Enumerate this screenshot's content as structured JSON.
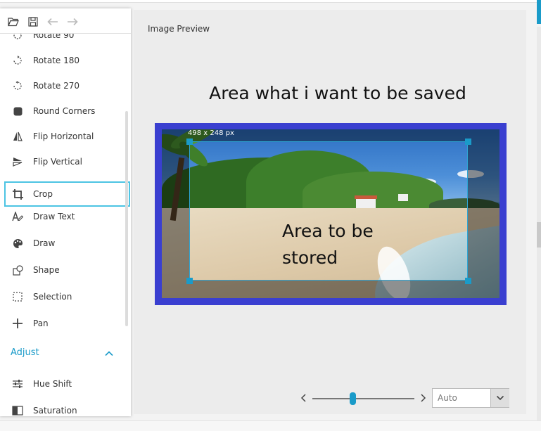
{
  "toolbar": {
    "icons": [
      "folder-open-icon",
      "save-icon",
      "undo-icon",
      "redo-icon"
    ]
  },
  "menu": {
    "items": [
      {
        "label": "Rotate 90",
        "icon": "rotate-90-icon"
      },
      {
        "label": "Rotate 180",
        "icon": "rotate-180-icon"
      },
      {
        "label": "Rotate 270",
        "icon": "rotate-270-icon"
      },
      {
        "label": "Round Corners",
        "icon": "round-corners-icon"
      },
      {
        "label": "Flip Horizontal",
        "icon": "flip-horizontal-icon"
      },
      {
        "label": "Flip Vertical",
        "icon": "flip-vertical-icon"
      },
      {
        "label": "Crop",
        "icon": "crop-icon",
        "selected": true
      },
      {
        "label": "Draw Text",
        "icon": "draw-text-icon"
      },
      {
        "label": "Draw",
        "icon": "palette-icon"
      },
      {
        "label": "Shape",
        "icon": "shape-icon"
      },
      {
        "label": "Selection",
        "icon": "selection-icon"
      },
      {
        "label": "Pan",
        "icon": "pan-icon"
      }
    ],
    "adjust_section": {
      "label": "Adjust",
      "icon": "chevron-up-icon"
    },
    "adjust_items": [
      {
        "label": "Hue Shift",
        "icon": "sliders-icon"
      },
      {
        "label": "Saturation",
        "icon": "saturation-icon"
      }
    ]
  },
  "preview": {
    "title": "Image Preview",
    "caption_top": "Area what i want to be saved",
    "crop_size": "498 x 248 px",
    "crop_caption": "Area to be stored"
  },
  "zoom": {
    "selected": "Auto",
    "prev_icon": "chevron-left-icon",
    "next_icon": "chevron-right-icon",
    "dropdown_icon": "chevron-down-icon",
    "slider_level": 0.39
  },
  "colors": {
    "accent": "#1a9bc9",
    "selection_border": "#4cc4e3",
    "image_frame": "#3a3fd0"
  }
}
